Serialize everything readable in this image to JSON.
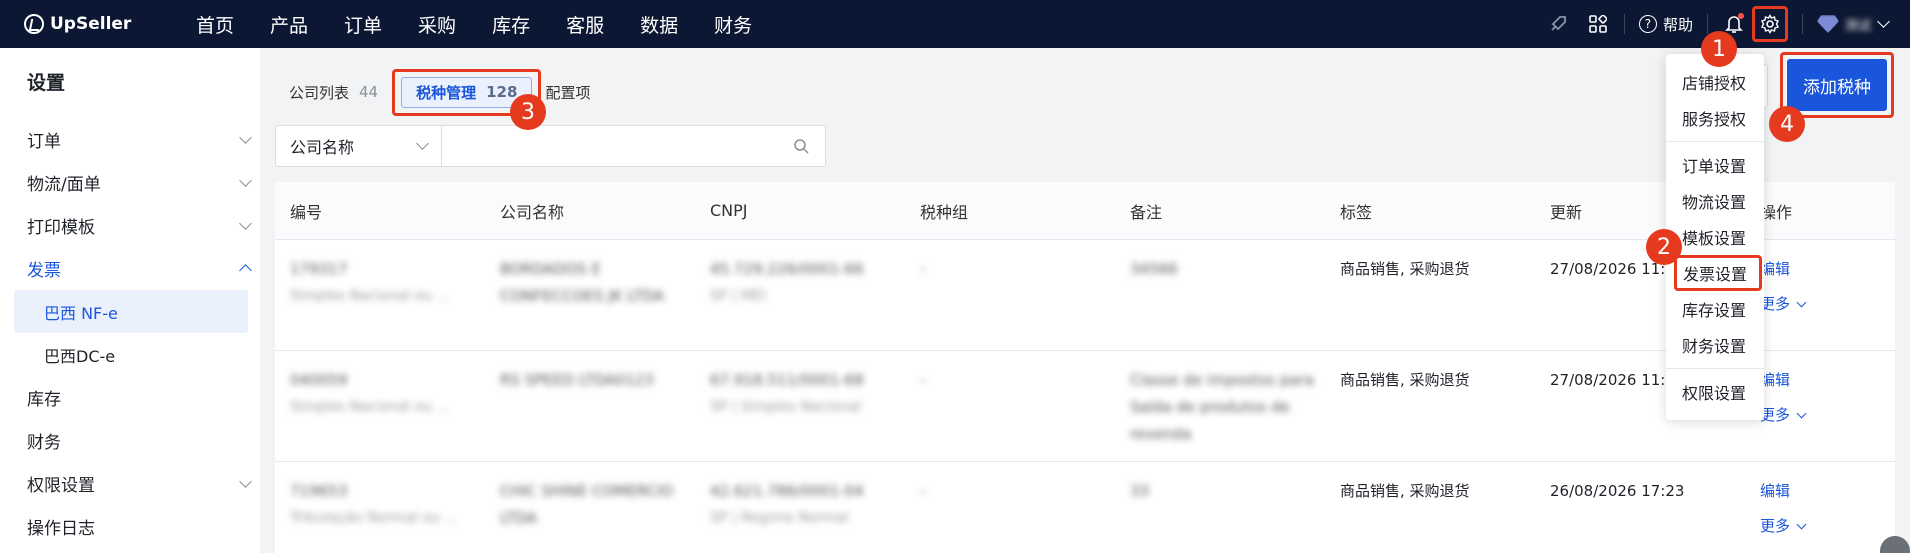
{
  "brand": {
    "name": "UpSeller"
  },
  "nav": [
    "首页",
    "产品",
    "订单",
    "采购",
    "库存",
    "客服",
    "数据",
    "财务"
  ],
  "topbar": {
    "help_label": "帮助",
    "user_name": "测试"
  },
  "sidebar": {
    "title": "设置",
    "items": [
      {
        "label": "订单",
        "expandable": true
      },
      {
        "label": "物流/面单",
        "expandable": true
      },
      {
        "label": "打印模板",
        "expandable": true
      },
      {
        "label": "发票",
        "expandable": true,
        "expanded": true
      },
      {
        "label": "巴西 NF-e",
        "sub": true,
        "active": true
      },
      {
        "label": "巴西DC-e",
        "sub": true
      },
      {
        "label": "库存"
      },
      {
        "label": "财务"
      },
      {
        "label": "权限设置",
        "expandable": true
      },
      {
        "label": "操作日志"
      }
    ]
  },
  "tabs": [
    {
      "label": "公司列表",
      "count": "44"
    },
    {
      "label": "税种管理",
      "count": "128",
      "active": true
    },
    {
      "label": "配置项",
      "count": ""
    }
  ],
  "filter": {
    "select_value": "公司名称",
    "search_placeholder": ""
  },
  "actions": {
    "add_label": "添加税种"
  },
  "table": {
    "headers": [
      "编号",
      "公司名称",
      "CNPJ",
      "税种组",
      "备注",
      "标签",
      "更新",
      "操作"
    ],
    "rows": [
      {
        "id": "179317",
        "id_sub": "Simples Nacional ou ...",
        "company": "BORDADOS E CONFECCOES JK LTDA",
        "cnpj": "45.729.226/0001-66",
        "cnpj_sub": "SP | MEI",
        "group": "-",
        "note": "34566",
        "tags": "商品销售, 采购退货",
        "updated": "27/08/2026 11:",
        "edit": "编辑",
        "more": "更多"
      },
      {
        "id": "040059",
        "id_sub": "Simples Nacional ou ...",
        "company": "RS SPEED LTDA0123",
        "cnpj": "67.918.511/0001-68",
        "cnpj_sub": "SP | Simples Nacional",
        "group": "-",
        "note": "Classe de impostos para Saída de produtos de revenda",
        "tags": "商品销售, 采购退货",
        "updated": "27/08/2026 11:1",
        "edit": "编辑",
        "more": "更多"
      },
      {
        "id": "719653",
        "id_sub": "Tributação Normal ou ...",
        "company": "CHIC SHINE COMERCIO LTDA",
        "cnpj": "42.621.786/0001-04",
        "cnpj_sub": "SP | Regime Normal",
        "group": "-",
        "note": "33",
        "tags": "商品销售, 采购退货",
        "updated": "26/08/2026 17:23",
        "edit": "编辑",
        "more": "更多"
      }
    ]
  },
  "settings_menu": [
    "店铺授权",
    "服务授权",
    "订单设置",
    "物流设置",
    "模板设置",
    "发票设置",
    "库存设置",
    "财务设置",
    "权限设置"
  ],
  "annotations": [
    "1",
    "2",
    "3",
    "4"
  ],
  "colors": {
    "topbar": "#0c1833",
    "accent": "#1a56db",
    "highlight": "#e63a1f"
  }
}
